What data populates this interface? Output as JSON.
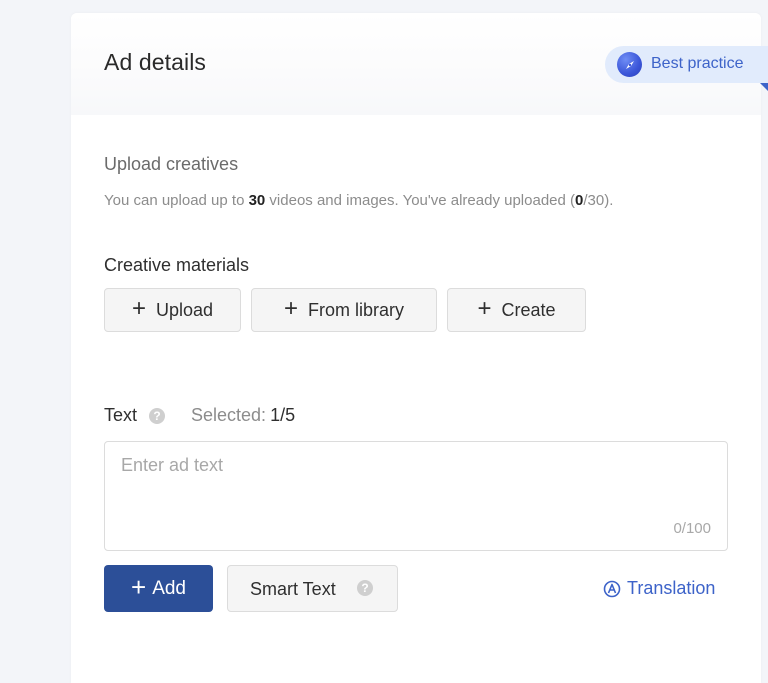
{
  "header": {
    "title": "Ad details",
    "best_practice_label": "Best practice",
    "best_practice_icon": "compass-icon"
  },
  "upload": {
    "section_title": "Upload creatives",
    "hint_prefix": "You can upload up to ",
    "hint_max": "30",
    "hint_middle": " videos and images. You've already uploaded (",
    "hint_uploaded": "0",
    "hint_suffix": "/30)."
  },
  "materials": {
    "title": "Creative materials",
    "buttons": [
      {
        "label": "Upload",
        "icon": "plus-icon"
      },
      {
        "label": "From library",
        "icon": "plus-icon"
      },
      {
        "label": "Create",
        "icon": "plus-icon"
      }
    ]
  },
  "text_section": {
    "label": "Text",
    "help_icon": "question-icon",
    "selected_label": "Selected:",
    "selected_value": "1/5",
    "placeholder": "Enter ad text",
    "char_count": "0/100"
  },
  "actions": {
    "add_label": "Add",
    "smart_text_label": "Smart Text",
    "translation_label": "Translation"
  },
  "colors": {
    "primary": "#2c4f98",
    "link": "#3d63c9",
    "badge_bg": "#e1ebfc"
  }
}
